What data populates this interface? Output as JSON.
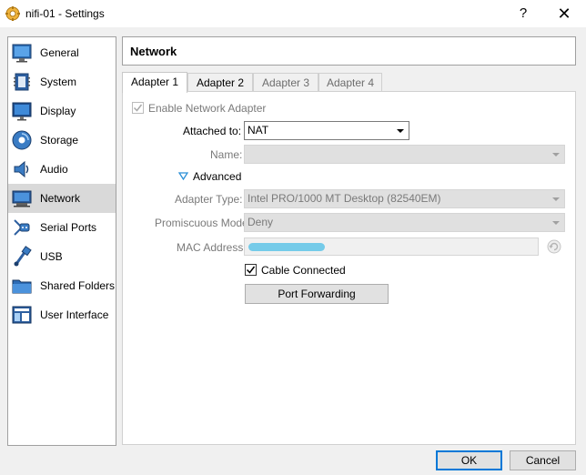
{
  "window": {
    "title": "nifi-01 - Settings",
    "help_label": "?",
    "close_label": "✕"
  },
  "sidebar": {
    "items": [
      {
        "label": "General",
        "icon": "general-icon",
        "selected": false
      },
      {
        "label": "System",
        "icon": "system-icon",
        "selected": false
      },
      {
        "label": "Display",
        "icon": "display-icon",
        "selected": false
      },
      {
        "label": "Storage",
        "icon": "storage-icon",
        "selected": false
      },
      {
        "label": "Audio",
        "icon": "audio-icon",
        "selected": false
      },
      {
        "label": "Network",
        "icon": "network-icon",
        "selected": true
      },
      {
        "label": "Serial Ports",
        "icon": "serial-ports-icon",
        "selected": false
      },
      {
        "label": "USB",
        "icon": "usb-icon",
        "selected": false
      },
      {
        "label": "Shared Folders",
        "icon": "shared-folders-icon",
        "selected": false
      },
      {
        "label": "User Interface",
        "icon": "user-interface-icon",
        "selected": false
      }
    ]
  },
  "page": {
    "title": "Network"
  },
  "tabs": [
    {
      "label": "Adapter 1",
      "state": "active"
    },
    {
      "label": "Adapter 2",
      "state": "normal"
    },
    {
      "label": "Adapter 3",
      "state": "disabled"
    },
    {
      "label": "Adapter 4",
      "state": "disabled"
    }
  ],
  "adapter": {
    "enable_label": "Enable Network Adapter",
    "enable_checked": true,
    "attached_to_label": "Attached to:",
    "attached_to_value": "NAT",
    "name_label": "Name:",
    "name_value": "",
    "advanced_label": "Advanced",
    "adapter_type_label": "Adapter Type:",
    "adapter_type_value": "Intel PRO/1000 MT Desktop (82540EM)",
    "promiscuous_label": "Promiscuous Mode:",
    "promiscuous_value": "Deny",
    "mac_label": "MAC Address:",
    "cable_label": "Cable Connected",
    "cable_checked": true,
    "port_forwarding_label": "Port Forwarding"
  },
  "footer": {
    "ok_label": "OK",
    "cancel_label": "Cancel"
  },
  "colors": {
    "accent": "#0078d7",
    "advanced_arrow": "#2a8fd6",
    "mac_redaction": "#67c6e8",
    "selected_item": "#d9d9d9"
  }
}
